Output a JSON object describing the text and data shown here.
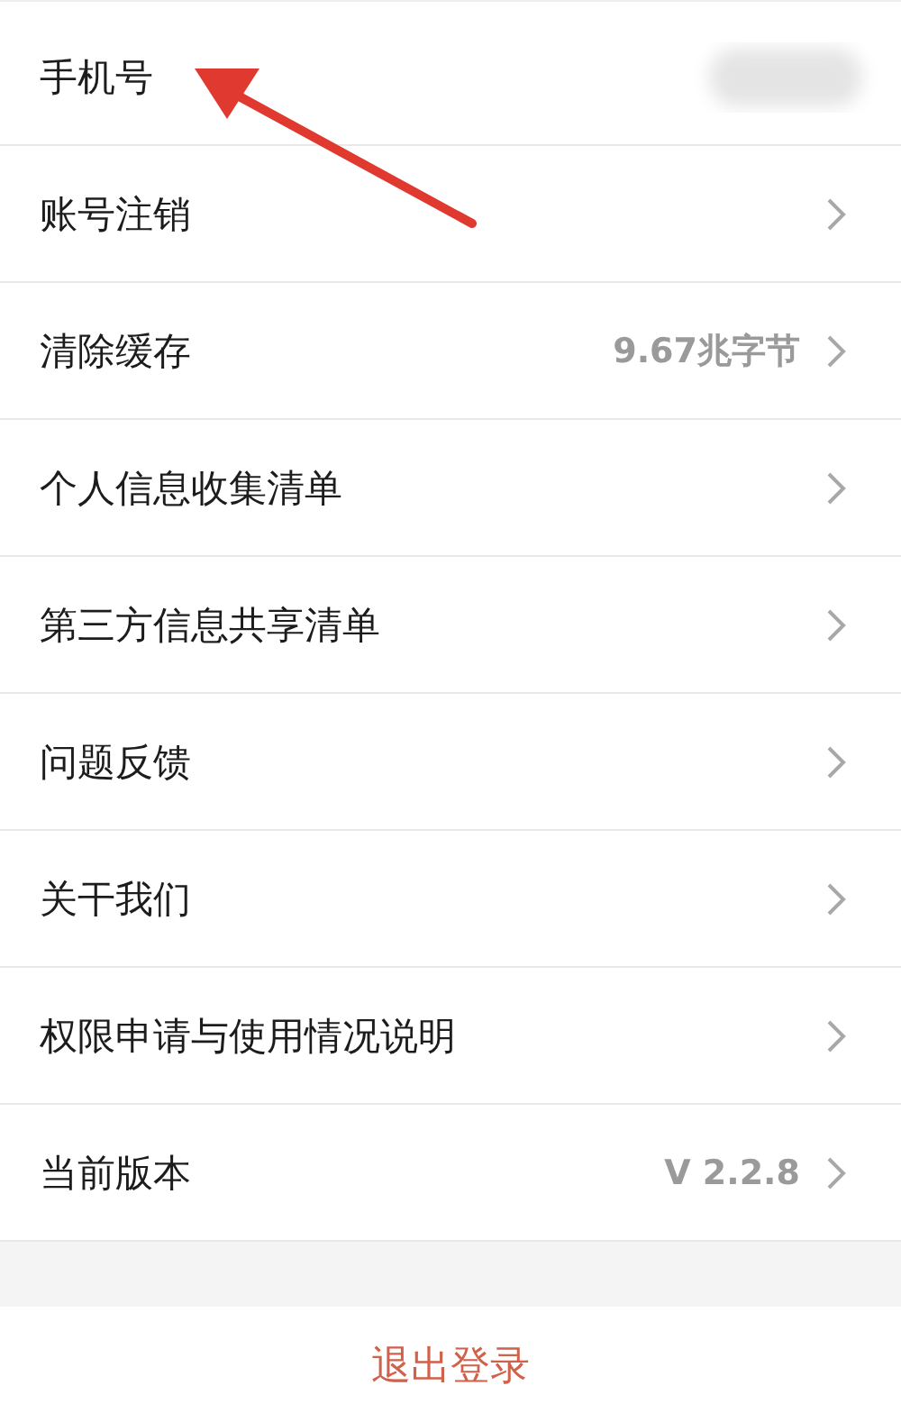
{
  "settings": [
    {
      "label": "手机号",
      "kind": "redacted"
    },
    {
      "label": "账号注销",
      "kind": "link"
    },
    {
      "label": "清除缓存",
      "kind": "link",
      "value": "9.67兆字节"
    },
    {
      "label": "个人信息收集清单",
      "kind": "link"
    },
    {
      "label": "第三方信息共享清单",
      "kind": "link"
    },
    {
      "label": "问题反馈",
      "kind": "link"
    },
    {
      "label": "关干我们",
      "kind": "link"
    },
    {
      "label": "权限申请与使用情况说明",
      "kind": "link"
    },
    {
      "label": "当前版本",
      "kind": "link",
      "value": "V 2.2.8"
    }
  ],
  "logout_button": "退出登录"
}
